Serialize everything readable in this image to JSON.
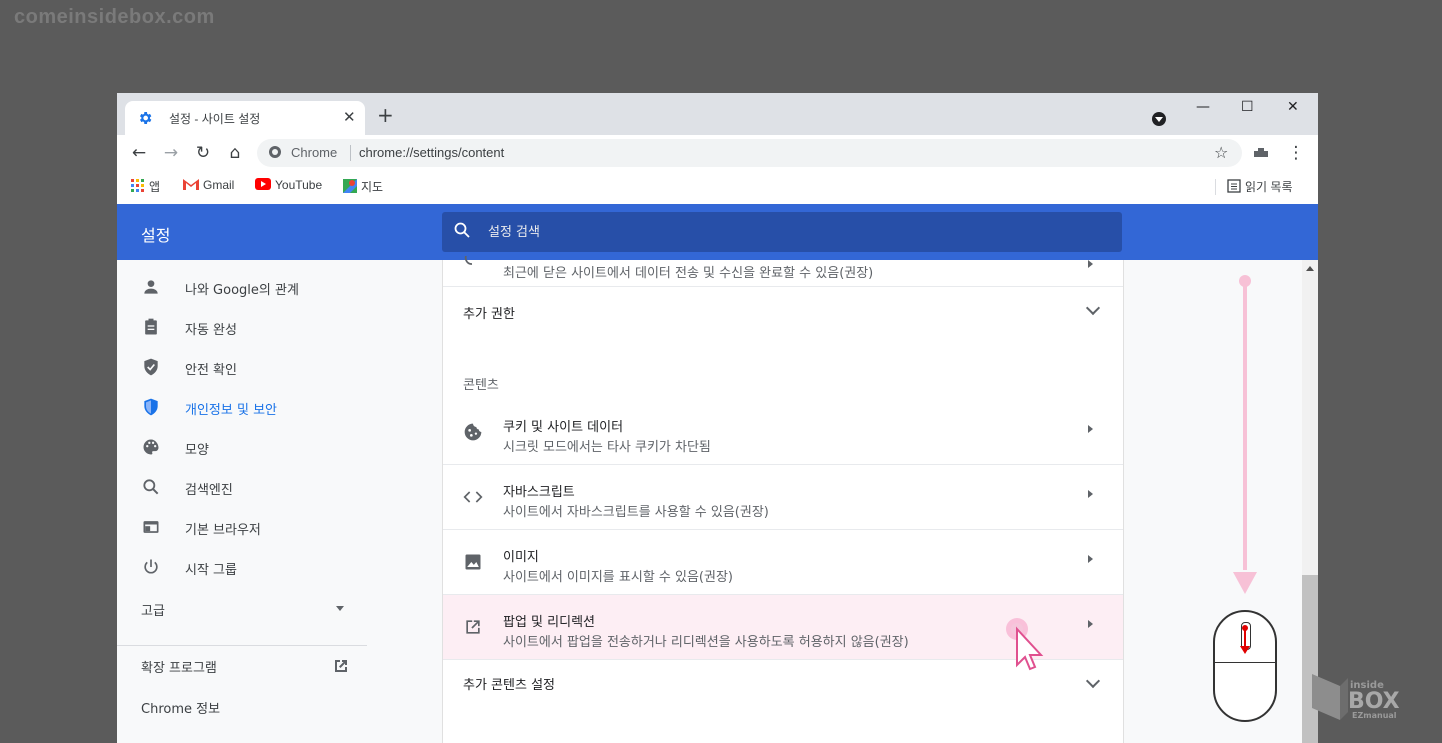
{
  "watermark": "comeinsidebox.com",
  "tab": {
    "title": "설정 - 사이트 설정",
    "close": "✕",
    "new_tab": "+"
  },
  "window_controls": {
    "minimize": "—",
    "maximize": "☐",
    "close": "✕"
  },
  "toolbar": {
    "back": "←",
    "forward": "→",
    "reload": "↻",
    "home": "⌂",
    "site_label": "Chrome",
    "url": "chrome://settings/content",
    "star": "☆",
    "menu": "⋮"
  },
  "bookmarks": {
    "items": [
      "앱",
      "Gmail",
      "YouTube",
      "지도"
    ],
    "reading_list": "읽기 목록"
  },
  "settings_header": {
    "title": "설정",
    "search_placeholder": "설정 검색"
  },
  "nav": {
    "items": [
      {
        "label": "나와 Google의 관계",
        "icon": "person-icon",
        "active": false
      },
      {
        "label": "자동 완성",
        "icon": "clipboard-icon",
        "active": false
      },
      {
        "label": "안전 확인",
        "icon": "shield-check-icon",
        "active": false
      },
      {
        "label": "개인정보 및 보안",
        "icon": "shield-icon",
        "active": true
      },
      {
        "label": "모양",
        "icon": "palette-icon",
        "active": false
      },
      {
        "label": "검색엔진",
        "icon": "search-icon",
        "active": false
      },
      {
        "label": "기본 브라우저",
        "icon": "browser-icon",
        "active": false
      },
      {
        "label": "시작 그룹",
        "icon": "power-icon",
        "active": false
      }
    ],
    "advanced": "고급",
    "extensions": "확장 프로그램",
    "about": "Chrome 정보"
  },
  "content": {
    "partial_row_sub": "최근에 닫은 사이트에서 데이터 전송 및 수신을 완료할 수 있음(권장)",
    "additional_permissions": "추가 권한",
    "section_label": "콘텐츠",
    "rows": [
      {
        "title": "쿠키 및 사이트 데이터",
        "sub": "시크릿 모드에서는 타사 쿠키가 차단됨",
        "icon": "cookie-icon"
      },
      {
        "title": "자바스크립트",
        "sub": "사이트에서 자바스크립트를 사용할 수 있음(권장)",
        "icon": "code-icon"
      },
      {
        "title": "이미지",
        "sub": "사이트에서 이미지를 표시할 수 있음(권장)",
        "icon": "image-icon"
      },
      {
        "title": "팝업 및 리디렉션",
        "sub": "사이트에서 팝업을 전송하거나 리디렉션을 사용하도록 허용하지 않음(권장)",
        "icon": "open-in-new-icon"
      }
    ],
    "additional_content": "추가 콘텐츠 설정"
  },
  "highlight_color": "#fdeef4",
  "accent_color": "#3367d6"
}
